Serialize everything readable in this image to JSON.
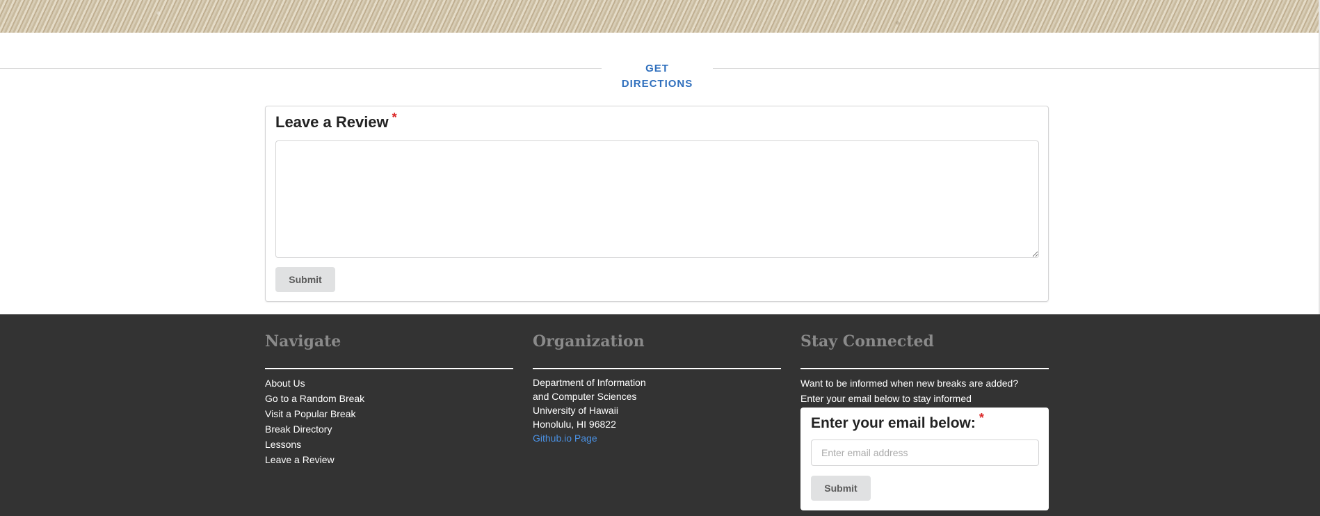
{
  "directions": {
    "label": "GET DIRECTIONS"
  },
  "review": {
    "title": "Leave a Review",
    "required_marker": "*",
    "submit_label": "Submit"
  },
  "footer": {
    "navigate": {
      "heading": "Navigate",
      "links": [
        "About Us",
        "Go to a Random Break",
        "Visit a Popular Break",
        "Break Directory",
        "Lessons",
        "Leave a Review"
      ]
    },
    "organization": {
      "heading": "Organization",
      "lines": [
        "Department of Information",
        "and Computer Sciences",
        "University of Hawaii",
        "Honolulu, HI 96822"
      ],
      "link_label": "Github.io Page"
    },
    "stay_connected": {
      "heading": "Stay Connected",
      "line1": "Want to be informed when new breaks are added?",
      "line2": "Enter your email below to stay informed",
      "email_title": "Enter your email below:",
      "required_marker": "*",
      "email_placeholder": "Enter email address",
      "submit_label": "Submit"
    }
  },
  "colors": {
    "accent_link": "#2f6fbd",
    "footer_bg": "#333333",
    "required": "#db2828",
    "button_bg": "#e0e1e2"
  }
}
